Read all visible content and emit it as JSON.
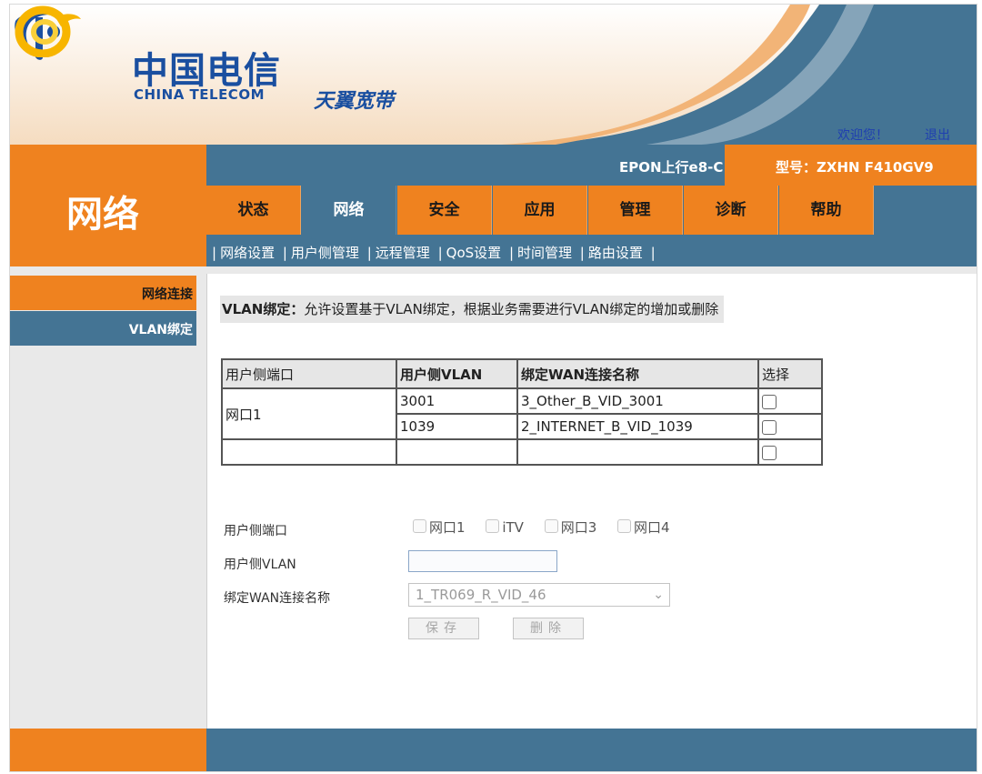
{
  "brand": {
    "cn_name": "中国电信",
    "en_name": "CHINA TELECOM",
    "tianyi": "天翼宽带"
  },
  "header": {
    "welcome": "欢迎您！",
    "logout": "退出",
    "epon": "EPON上行e8-C",
    "model": "型号：ZXHN F410GV9",
    "section_title": "网络"
  },
  "tabs": [
    {
      "label": "状态",
      "active": false
    },
    {
      "label": "网络",
      "active": true
    },
    {
      "label": "安全",
      "active": false
    },
    {
      "label": "应用",
      "active": false
    },
    {
      "label": "管理",
      "active": false
    },
    {
      "label": "诊断",
      "active": false
    },
    {
      "label": "帮助",
      "active": false
    }
  ],
  "subnav": [
    "网络设置",
    "用户侧管理",
    "远程管理",
    "QoS设置",
    "时间管理",
    "路由设置"
  ],
  "sidebar": {
    "items": [
      {
        "label": "网络连接",
        "active": false
      },
      {
        "label": "VLAN绑定",
        "active": true
      }
    ]
  },
  "description": {
    "prefix": "VLAN绑定：",
    "text": "允许设置基于VLAN绑定，根据业务需要进行VLAN绑定的增加或删除"
  },
  "table": {
    "headers": [
      "用户侧端口",
      "用户侧VLAN",
      "绑定WAN连接名称",
      "选择"
    ],
    "port": "网口1",
    "rows": [
      {
        "vlan": "3001",
        "wan": "3_Other_B_VID_3001"
      },
      {
        "vlan": "1039",
        "wan": "2_INTERNET_B_VID_1039"
      },
      {
        "vlan": "",
        "wan": ""
      }
    ]
  },
  "form": {
    "port_label": "用户侧端口",
    "ports": [
      "网口1",
      "iTV",
      "网口3",
      "网口4"
    ],
    "vlan_label": "用户侧VLAN",
    "vlan_value": "",
    "wan_label": "绑定WAN连接名称",
    "wan_selected": "1_TR069_R_VID_46",
    "save_label": "保存",
    "delete_label": "删除"
  },
  "colors": {
    "orange": "#ef821f",
    "blue": "#447494",
    "link": "#1f3fb0"
  },
  "icons": [
    "china-telecom-logo-icon",
    "tianyi-logo-icon",
    "checkbox-icon",
    "chevron-down-icon"
  ]
}
